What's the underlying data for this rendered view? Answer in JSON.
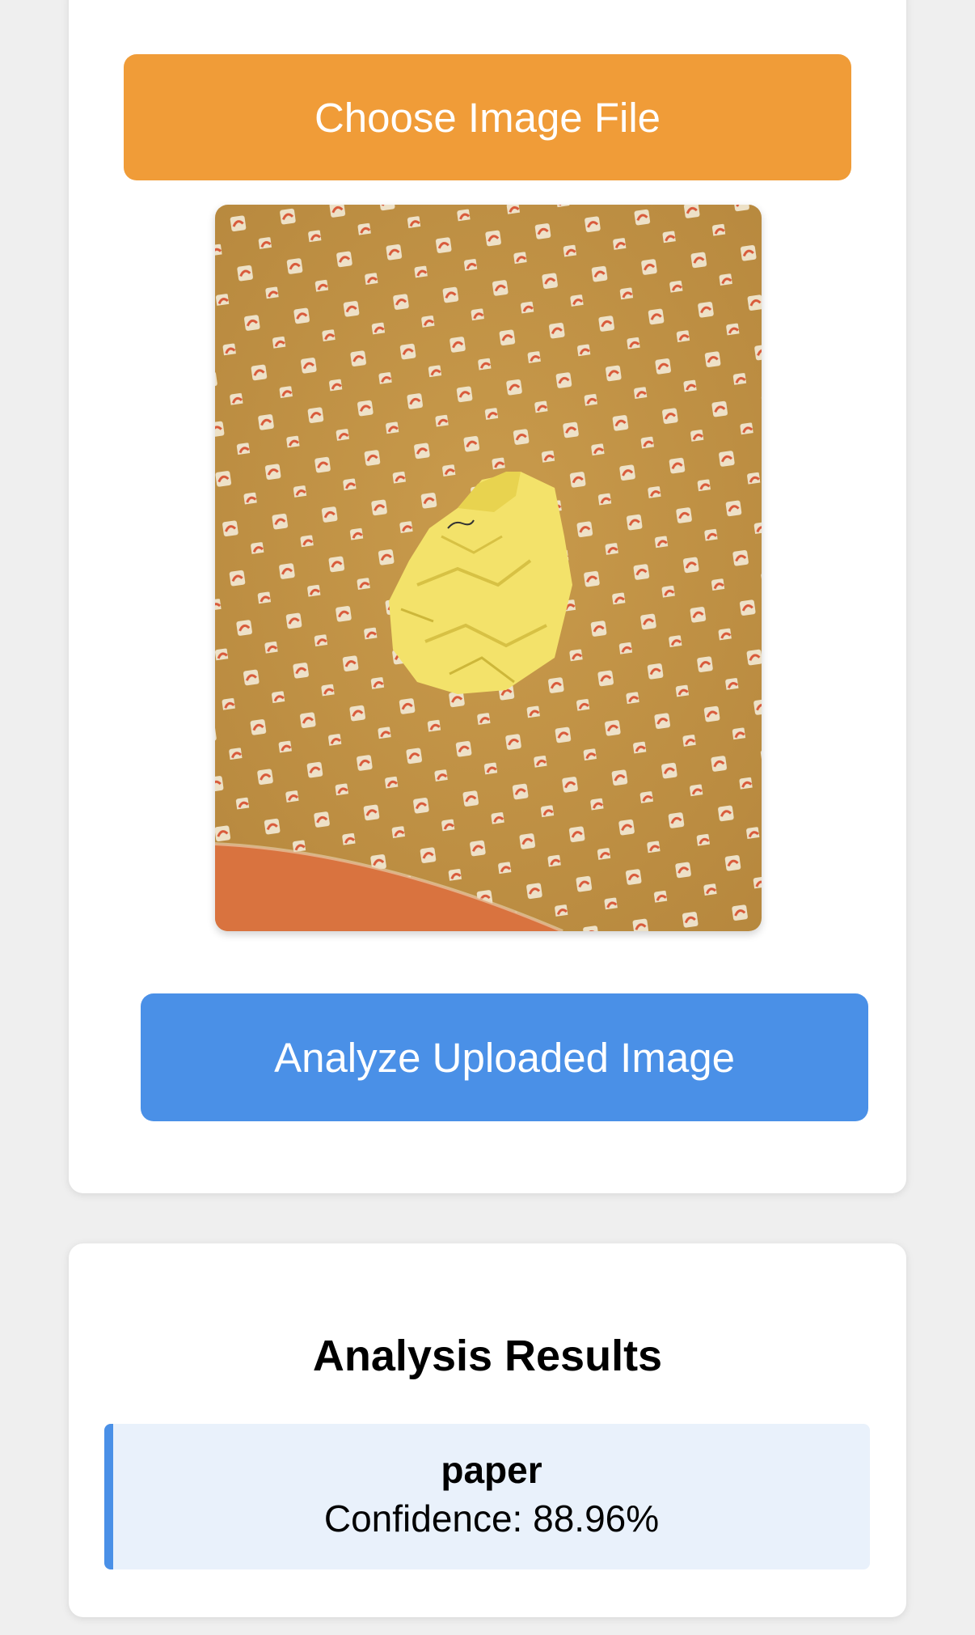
{
  "upload": {
    "choose_label": "Choose Image File",
    "analyze_label": "Analyze Uploaded Image",
    "preview_description_icon": "crumpled-yellow-paper-photo"
  },
  "results": {
    "title": "Analysis Results",
    "items": [
      {
        "label": "paper",
        "confidence_prefix": "Confidence:",
        "confidence_value": "88.96%",
        "confidence_text": "Confidence: 88.96%"
      }
    ]
  },
  "colors": {
    "choose_button": "#f09c38",
    "analyze_button": "#4a90e7",
    "result_accent": "#4a90e7",
    "result_background": "#e9f1fb",
    "page_background": "#efefef"
  }
}
